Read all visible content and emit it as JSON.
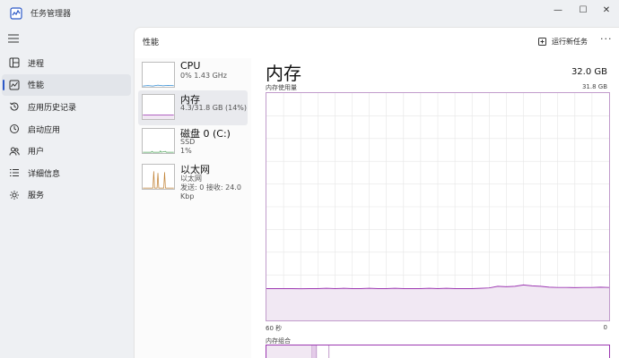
{
  "window": {
    "title": "任务管理器",
    "controls": {
      "minimize": "—",
      "maximize": "☐",
      "close": "✕"
    }
  },
  "nav": {
    "items": [
      {
        "label": "进程",
        "icon": "processes-icon"
      },
      {
        "label": "性能",
        "icon": "performance-icon",
        "active": true
      },
      {
        "label": "应用历史记录",
        "icon": "app-history-icon"
      },
      {
        "label": "启动应用",
        "icon": "startup-icon"
      },
      {
        "label": "用户",
        "icon": "users-icon"
      },
      {
        "label": "详细信息",
        "icon": "details-icon"
      },
      {
        "label": "服务",
        "icon": "services-icon"
      }
    ]
  },
  "header": {
    "title": "性能",
    "run_task": "运行新任务",
    "more": "···"
  },
  "resources": [
    {
      "name": "CPU",
      "lines": [
        "0% 1.43 GHz"
      ]
    },
    {
      "name": "内存",
      "lines": [
        "4.3/31.8 GB (14%)"
      ],
      "active": true
    },
    {
      "name": "磁盘 0 (C:)",
      "lines": [
        "SSD",
        "1%"
      ]
    },
    {
      "name": "以太网",
      "lines": [
        "以太网",
        "发送: 0 接收: 24.0 Kbp"
      ]
    }
  ],
  "memory": {
    "title": "内存",
    "total": "32.0 GB",
    "usage_label": "内存使用量",
    "max": "31.8 GB",
    "time_left": "60 秒",
    "time_right": "0",
    "composition_label": "内存组合",
    "usage_fraction": [
      0.14,
      0.14,
      0.14,
      0.14,
      0.139,
      0.14,
      0.14,
      0.141,
      0.14,
      0.141,
      0.14,
      0.14,
      0.141,
      0.14,
      0.14,
      0.141,
      0.14,
      0.14,
      0.14,
      0.141,
      0.14,
      0.141,
      0.14,
      0.14,
      0.14,
      0.141,
      0.143,
      0.15,
      0.148,
      0.15,
      0.156,
      0.152,
      0.15,
      0.146,
      0.145,
      0.145,
      0.144,
      0.145,
      0.145,
      0.146,
      0.145
    ]
  },
  "colors": {
    "accent": "#2d59c8",
    "memory_line": "#9c37b1",
    "memory_fill": "#f1e8f3",
    "grid": "#e6e6e6",
    "network_line": "#c2853a",
    "disk_line": "#4fa35a",
    "cpu_line": "#2f8bd3"
  }
}
